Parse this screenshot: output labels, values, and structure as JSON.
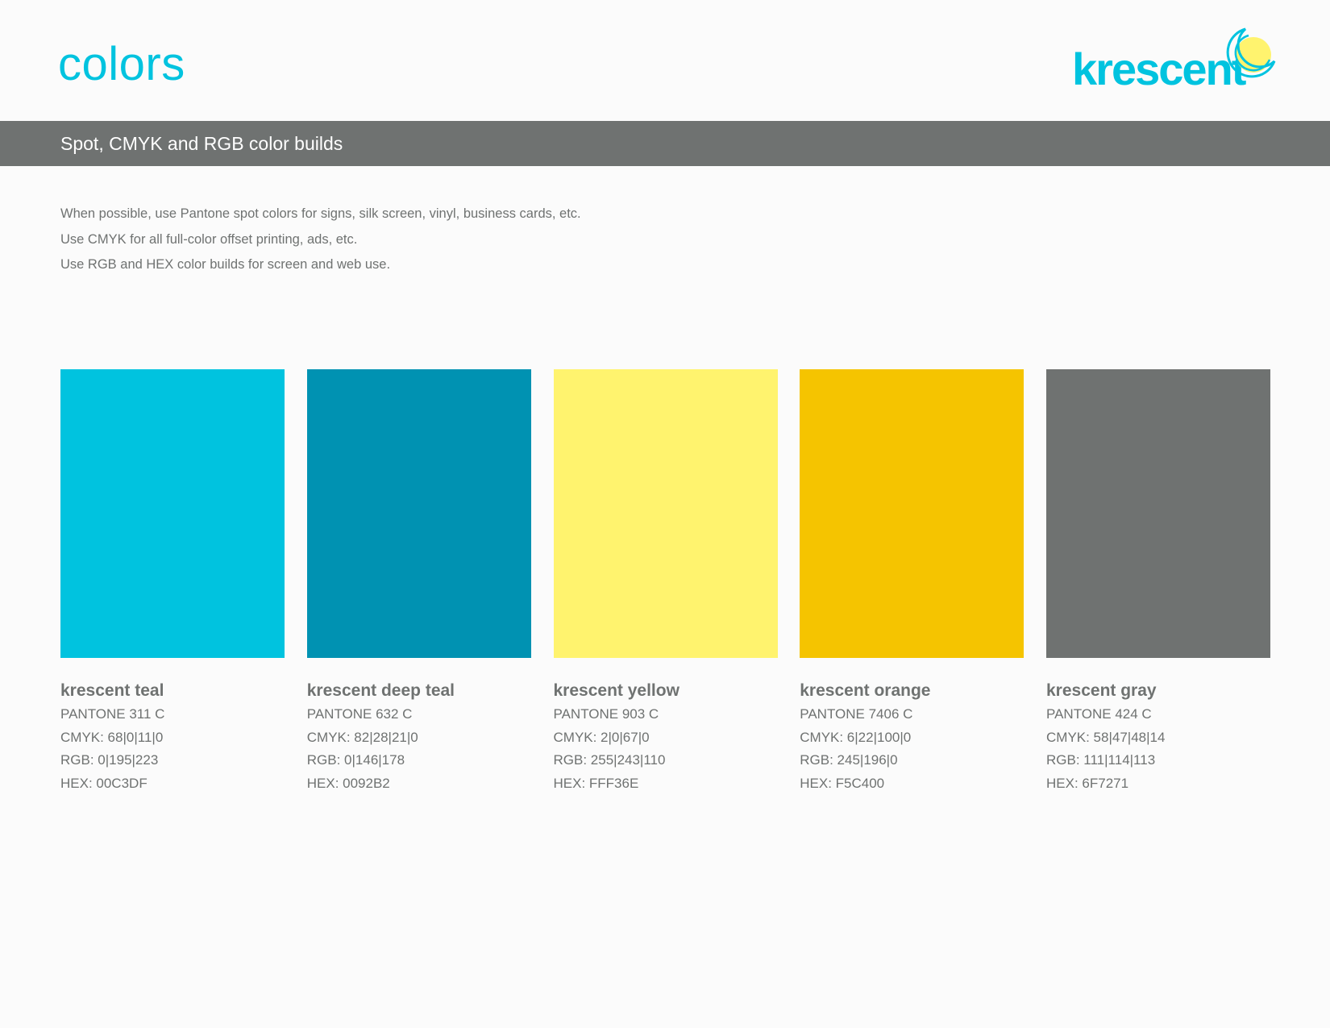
{
  "page": {
    "title": "colors",
    "title_color": "#00c3df",
    "background": "#fbfbfb"
  },
  "logo": {
    "text": "krescent",
    "text_color": "#00c3df",
    "moon_color": "#fff36e",
    "moon_outline_color": "#00c3df"
  },
  "banner": {
    "text": "Spot, CMYK and RGB color builds",
    "color": "#6f7271"
  },
  "intro": {
    "lines": [
      "When possible, use Pantone spot colors for signs, silk screen, vinyl, business cards, etc.",
      "Use CMYK for all full-color offset printing, ads, etc.",
      "Use RGB and HEX color builds for screen and web use."
    ]
  },
  "swatches": [
    {
      "name": "krescent teal",
      "pantone": "PANTONE 311 C",
      "cmyk": "CMYK: 68|0|11|0",
      "rgb": "RGB: 0|195|223",
      "hex": "HEX: 00C3DF",
      "color": "#00c3df"
    },
    {
      "name": "krescent deep teal",
      "pantone": "PANTONE 632 C",
      "cmyk": "CMYK: 82|28|21|0",
      "rgb": "RGB: 0|146|178",
      "hex": "HEX: 0092B2",
      "color": "#0092b2"
    },
    {
      "name": "krescent yellow",
      "pantone": "PANTONE 903 C",
      "cmyk": "CMYK: 2|0|67|0",
      "rgb": "RGB: 255|243|110",
      "hex": "HEX: FFF36E",
      "color": "#fff36e"
    },
    {
      "name": "krescent orange",
      "pantone": "PANTONE 7406 C",
      "cmyk": "CMYK: 6|22|100|0",
      "rgb": "RGB: 245|196|0",
      "hex": "HEX: F5C400",
      "color": "#f5c400"
    },
    {
      "name": "krescent gray",
      "pantone": "PANTONE 424 C",
      "cmyk": "CMYK: 58|47|48|14",
      "rgb": "RGB: 111|114|113",
      "hex": "HEX: 6F7271",
      "color": "#6f7271"
    }
  ]
}
